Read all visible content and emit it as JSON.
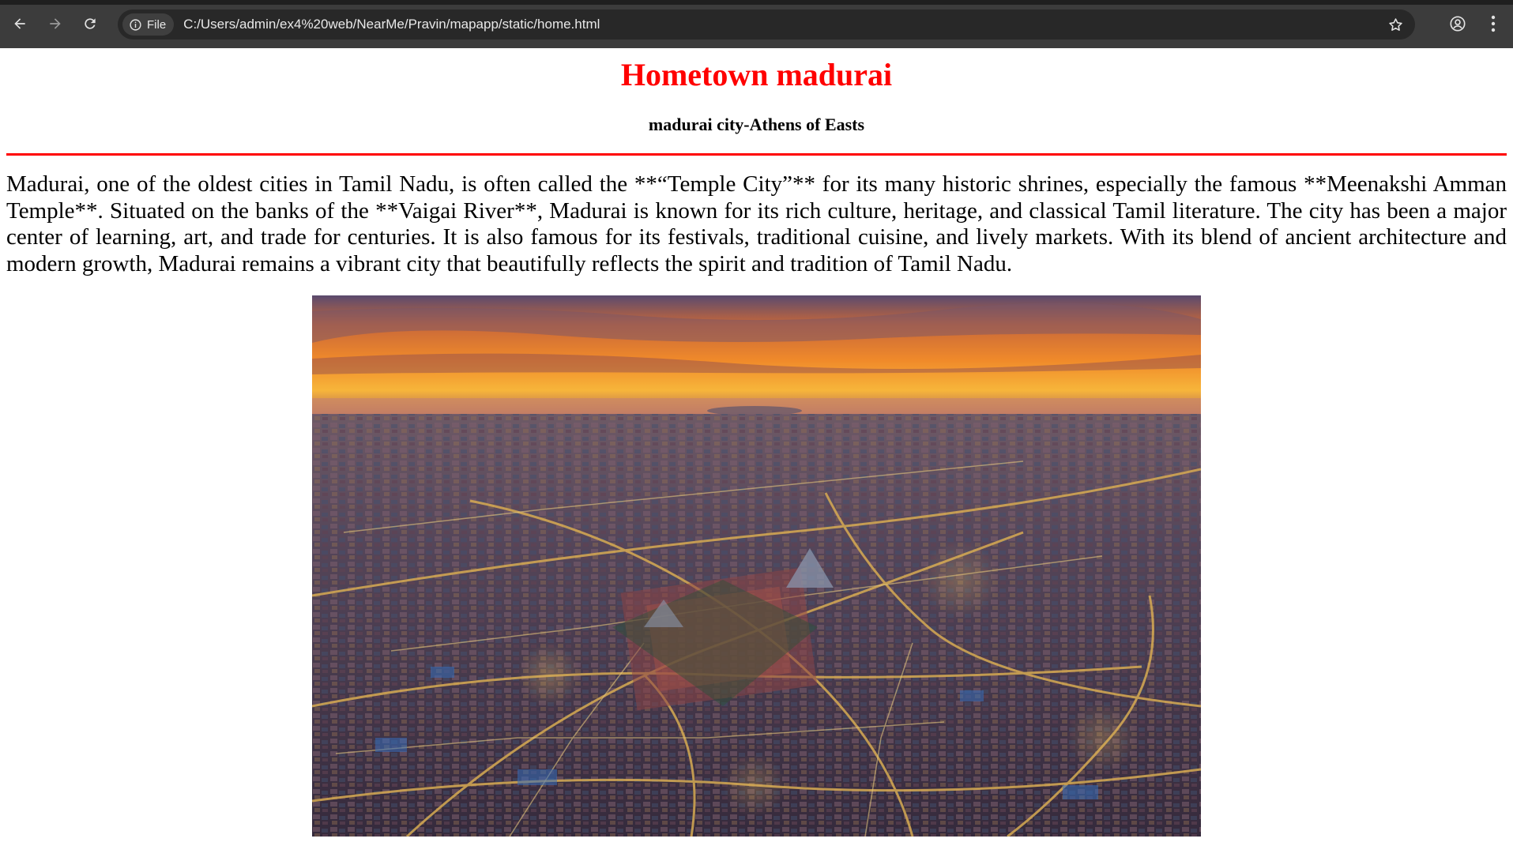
{
  "browser": {
    "file_chip_label": "File",
    "url": "C:/Users/admin/ex4%20web/NearMe/Pravin/mapapp/static/home.html",
    "icons": [
      "back-arrow-icon",
      "forward-arrow-icon",
      "reload-icon",
      "info-icon",
      "bookmark-star-icon",
      "profile-icon",
      "kebab-menu-icon"
    ]
  },
  "page": {
    "title": "Hometown madurai",
    "subtitle": "madurai city-Athens of Easts",
    "paragraph": "Madurai, one of the oldest cities in Tamil Nadu, is often called the **“Temple City”** for its many historic shrines, especially the famous **Meenakshi Amman Temple**. Situated on the banks of the **Vaigai River**, Madurai is known for its rich culture, heritage, and classical Tamil literature. The city has been a major center of learning, art, and trade for centuries. It is also famous for its festivals, traditional cuisine, and lively markets. With its blend of ancient architecture and modern growth, Madurai remains a vibrant city that beautifully reflects the spirit and tradition of Tamil Nadu."
  },
  "colors": {
    "title": "#ff0000",
    "divider": "#ff0000",
    "chrome_bg": "#3c3c3c",
    "omnibox_bg": "#282828"
  }
}
